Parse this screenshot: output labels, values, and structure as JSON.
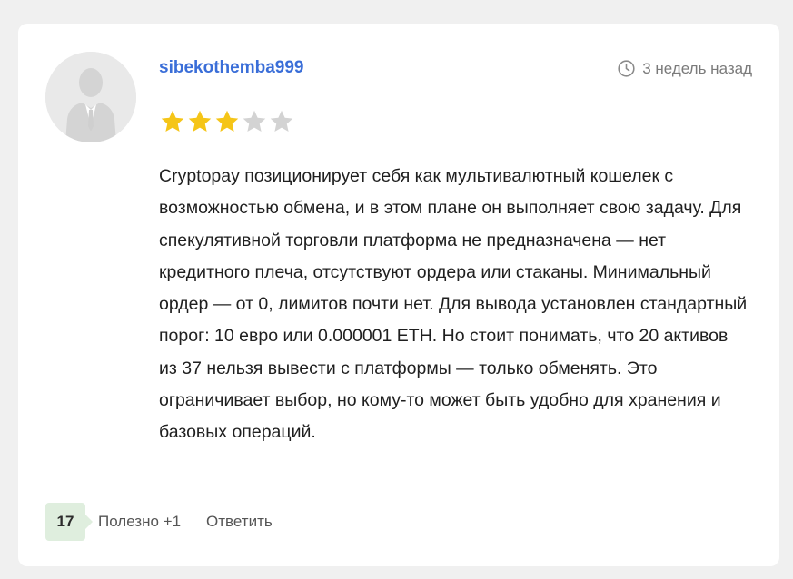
{
  "review": {
    "author": "sibekothemba999",
    "time": "3 недель назад",
    "rating": 3,
    "rating_max": 5,
    "text": "Cryptopay позиционирует себя как мультивалютный кошелек с возможностью обмена, и в этом плане он выполняет свою задачу. Для спекулятивной торговли платформа не предназначена — нет кредитного плеча, отсутствуют ордера или стаканы. Минимальный ордер — от 0, лимитов почти нет. Для вывода установлен стандартный порог: 10 евро или 0.000001 ETH. Но стоит понимать, что 20 активов из 37 нельзя вывести с платформы — только обменять. Это ограничивает выбор, но кому-то может быть удобно для хранения и базовых операций."
  },
  "footer": {
    "count": "17",
    "helpful_label": "Полезно +1",
    "reply_label": "Ответить"
  },
  "icons": {
    "avatar": "user-silhouette-icon",
    "time": "clock-icon",
    "star_filled": "star-filled-icon",
    "star_empty": "star-empty-icon"
  },
  "colors": {
    "username": "#3a6ed8",
    "star_filled": "#f5c518",
    "star_empty": "#d3d3d3",
    "badge_bg": "#dfeede",
    "page_bg": "#f0f0f0",
    "card_bg": "#ffffff"
  }
}
